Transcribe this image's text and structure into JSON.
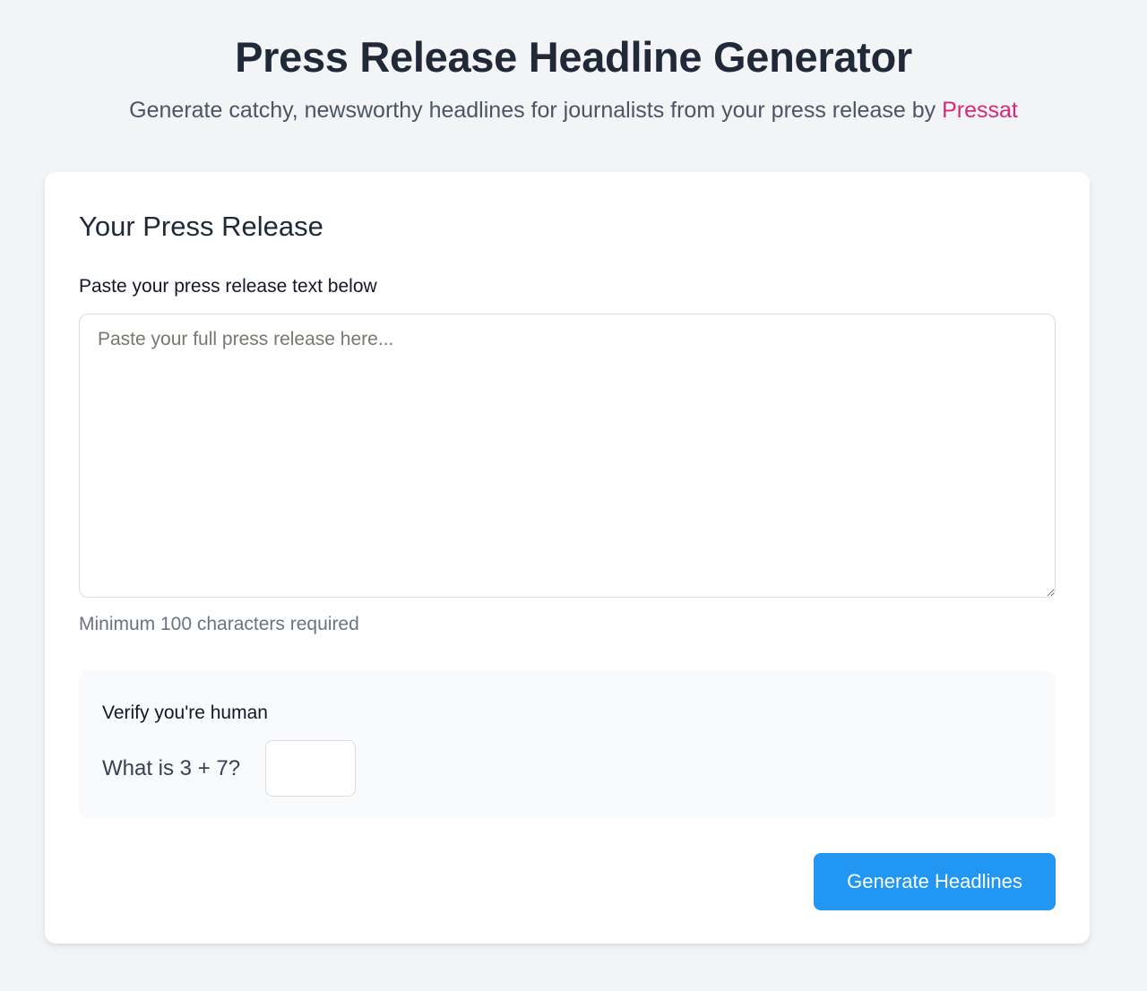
{
  "header": {
    "title": "Press Release Headline Generator",
    "subtitle": "Generate catchy, newsworthy headlines for journalists from your press release by ",
    "brand_link": "Pressat"
  },
  "form": {
    "section_title": "Your Press Release",
    "field_label": "Paste your press release text below",
    "textarea_value": "",
    "textarea_placeholder": "Paste your full press release here...",
    "hint": "Minimum 100 characters required",
    "captcha": {
      "title": "Verify you're human",
      "question": "What is 3 + 7?",
      "answer_value": ""
    },
    "submit_label": "Generate Headlines"
  },
  "colors": {
    "accent": "#2196f3",
    "brand_link": "#db2777",
    "background": "#f3f4f6"
  }
}
